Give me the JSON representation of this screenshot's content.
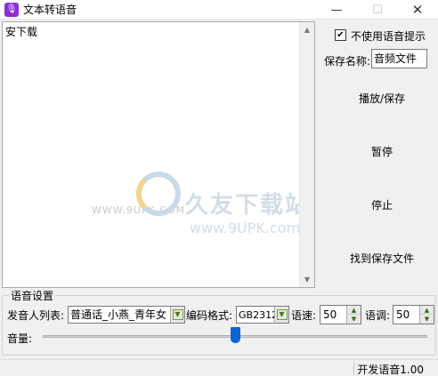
{
  "window": {
    "title": "文本转语音",
    "min_glyph": "—",
    "max_glyph": "☐",
    "close_glyph": "✕",
    "app_icon": "mic-icon",
    "app_icon_glyph": "🎙"
  },
  "text_area": {
    "content": "安下载"
  },
  "watermark": {
    "brand": "久友下载站",
    "site": "www.9UPK.com",
    "small": "WWW.9UPK.COM"
  },
  "options": {
    "checkbox_label": "不使用语音提示",
    "checkbox_checked": true,
    "check_glyph": "✔",
    "save_name_label": "保存名称:",
    "save_name_value": "音频文件"
  },
  "actions": {
    "play_save": "播放/保存",
    "pause": "暂停",
    "stop": "停止",
    "find_file": "找到保存文件"
  },
  "voice_settings": {
    "group_title": "语音设置",
    "speaker_label": "发音人列表:",
    "speaker_value": "普通话_小燕_青年女",
    "encoding_label": "编码格式:",
    "encoding_value": "GB2312",
    "speed_label": "语速:",
    "speed_value": "50",
    "pitch_label": "语调:",
    "pitch_value": "50",
    "volume_label": "音量:",
    "volume_fraction": 0.5
  },
  "statusbar": {
    "text": "开发语音1.00"
  },
  "colors": {
    "accent": "#0a64d2",
    "app_icon": "#8b2fd6",
    "combo_arrow_border": "#6f9f2b"
  }
}
